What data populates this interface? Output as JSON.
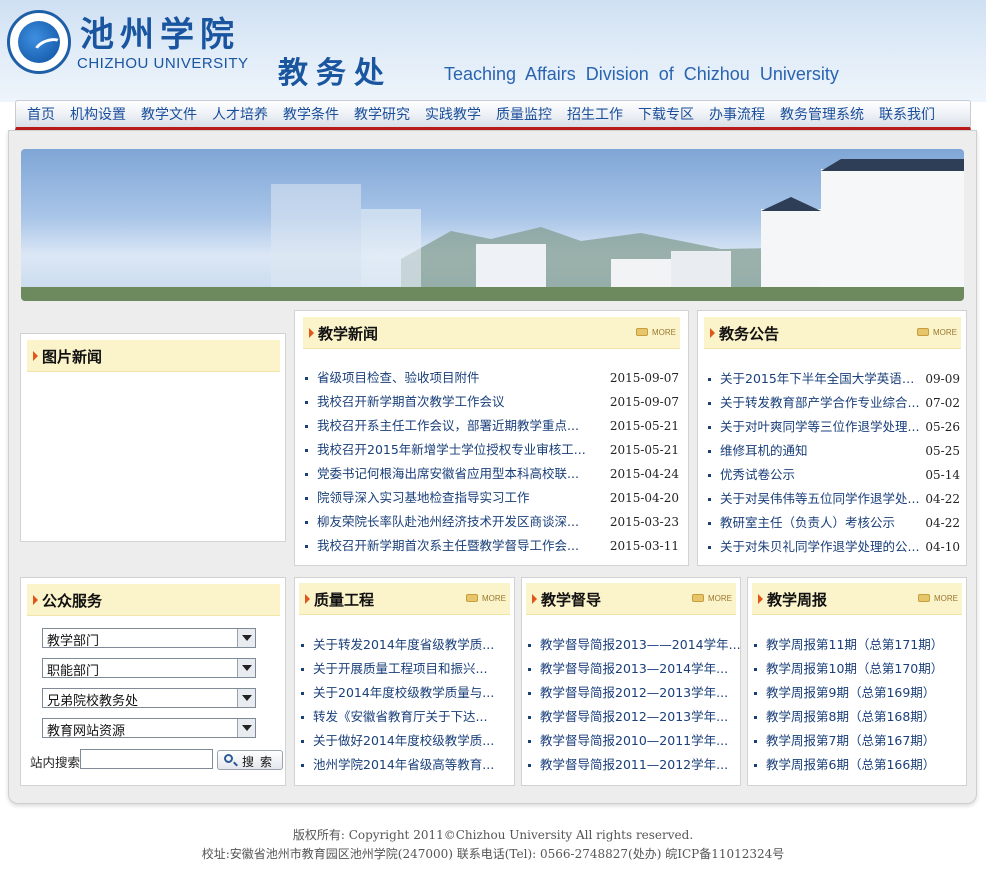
{
  "header": {
    "school_name_cn": "池州学院",
    "school_name_en": "CHIZHOU UNIVERSITY",
    "dept_name_cn": "教务处",
    "dept_name_en": "Teaching Affairs Division of Chizhou University"
  },
  "nav": {
    "items": [
      "首页",
      "机构设置",
      "教学文件",
      "人才培养",
      "教学条件",
      "教学研究",
      "实践教学",
      "质量监控",
      "招生工作",
      "下载专区",
      "办事流程",
      "教务管理系统",
      "联系我们"
    ]
  },
  "photo_news": {
    "title": "图片新闻"
  },
  "teaching_news": {
    "title": "教学新闻",
    "more_label": "MORE",
    "items": [
      {
        "text": "省级项目检查、验收项目附件",
        "date": "2015-09-07"
      },
      {
        "text": "我校召开新学期首次教学工作会议",
        "date": "2015-09-07"
      },
      {
        "text": "我校召开系主任工作会议，部署近期教学重点...",
        "date": "2015-05-21"
      },
      {
        "text": "我校召开2015年新增学士学位授权专业审核工...",
        "date": "2015-05-21"
      },
      {
        "text": "党委书记何根海出席安徽省应用型本科高校联...",
        "date": "2015-04-24"
      },
      {
        "text": "院领导深入实习基地检查指导实习工作",
        "date": "2015-04-20"
      },
      {
        "text": "柳友荣院长率队赴池州经济技术开发区商谈深...",
        "date": "2015-03-23"
      },
      {
        "text": "我校召开新学期首次系主任暨教学督导工作会...",
        "date": "2015-03-11"
      }
    ]
  },
  "announcements": {
    "title": "教务公告",
    "more_label": "MORE",
    "items": [
      {
        "text": "关于2015年下半年全国大学英语四...",
        "date": "09-09"
      },
      {
        "text": "关于转发教育部产学合作专业综合...",
        "date": "07-02"
      },
      {
        "text": "关于对叶爽同学等三位作退学处理...",
        "date": "05-26"
      },
      {
        "text": "维修耳机的通知",
        "date": "05-25"
      },
      {
        "text": "优秀试卷公示",
        "date": "05-14"
      },
      {
        "text": "关于对吴伟伟等五位同学作退学处...",
        "date": "04-22"
      },
      {
        "text": "教研室主任（负责人）考核公示",
        "date": "04-22"
      },
      {
        "text": "关于对朱贝礼同学作退学处理的公...",
        "date": "04-10"
      }
    ]
  },
  "public_service": {
    "title": "公众服务",
    "selects": [
      "教学部门",
      "职能部门",
      "兄弟院校教务处",
      "教育网站资源"
    ],
    "search_label": "站内搜索",
    "search_placeholder": "",
    "search_button": "搜索"
  },
  "quality": {
    "title": "质量工程",
    "more_label": "MORE",
    "items": [
      "关于转发2014年度省级教学质...",
      "关于开展质量工程项目和振兴...",
      "关于2014年度校级教学质量与...",
      "转发《安徽省教育厅关于下达...",
      "关于做好2014年度校级教学质...",
      "池州学院2014年省级高等教育..."
    ]
  },
  "supervision": {
    "title": "教学督导",
    "more_label": "MORE",
    "items": [
      "教学督导简报2013——2014学年...",
      "教学督导简报2013—2014学年...",
      "教学督导简报2012—2013学年...",
      "教学督导简报2012—2013学年...",
      "教学督导简报2010—2011学年...",
      "教学督导简报2011—2012学年..."
    ]
  },
  "weekly": {
    "title": "教学周报",
    "more_label": "MORE",
    "items": [
      "教学周报第11期（总第171期）",
      "教学周报第10期（总第170期）",
      "教学周报第9期（总第169期）",
      "教学周报第8期（总第168期）",
      "教学周报第7期（总第167期）",
      "教学周报第6期（总第166期）"
    ]
  },
  "footer": {
    "copyright": "版权所有: Copyright 2011©Chizhou University All rights reserved.",
    "address": "校址:安徽省池州市教育园区池州学院(247000) 联系电话(Tel): 0566-2748827(处办) 皖ICP备11012324号"
  },
  "colors": {
    "nav_text": "#1a4e9a",
    "nav_underline": "#b91a1a",
    "panel_title_bg": "#fbf3c9",
    "title_arrow": "#e0571b",
    "link_text": "#1a3f7a"
  }
}
